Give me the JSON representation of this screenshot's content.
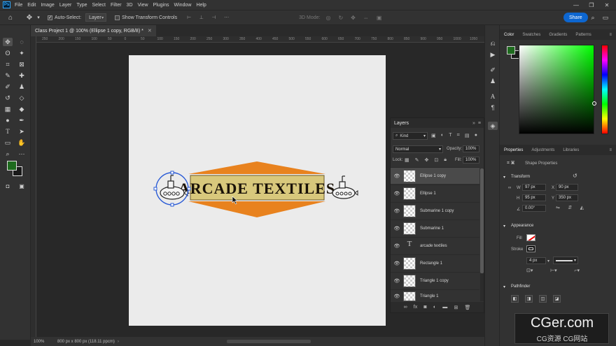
{
  "menu": {
    "logo": "Ps",
    "items": [
      "File",
      "Edit",
      "Image",
      "Layer",
      "Type",
      "Select",
      "Filter",
      "3D",
      "View",
      "Plugins",
      "Window",
      "Help"
    ]
  },
  "options": {
    "auto_select_label": "Auto-Select:",
    "auto_select_value": "Layer",
    "show_transform_label": "Show Transform Controls",
    "mode_3d_label": "3D Mode:",
    "share_label": "Share"
  },
  "document": {
    "tab_title": "Class Project 1 @ 100% (Ellipse 1 copy, RGB/8) *",
    "zoom": "100%",
    "doc_info": "800 px x 800 px (118.11 ppcm)"
  },
  "ruler": {
    "ticks": [
      "250",
      "200",
      "150",
      "100",
      "50",
      "0",
      "50",
      "100",
      "150",
      "200",
      "250",
      "300",
      "350",
      "400",
      "450",
      "500",
      "550",
      "600",
      "650",
      "700",
      "750",
      "800",
      "850",
      "900",
      "950",
      "1000",
      "1050"
    ]
  },
  "artwork": {
    "logo_text": "ARCADE TEXTILES",
    "orange": "#e8821e",
    "banner_fill": "#d8c87c",
    "text_color": "#1a1208",
    "selection_color": "#2a5bd6"
  },
  "tools": {
    "foreground": "#1e6b1e",
    "background": "#1a1a1a"
  },
  "layers_panel": {
    "title": "Layers",
    "filter_kind": "Kind",
    "blend_mode": "Normal",
    "opacity_label": "Opacity:",
    "opacity_value": "100%",
    "lock_label": "Lock:",
    "fill_label": "Fill:",
    "fill_value": "100%",
    "layers": [
      {
        "name": "Ellipse 1 copy",
        "type": "shape",
        "selected": true
      },
      {
        "name": "Ellipse 1",
        "type": "shape",
        "selected": false
      },
      {
        "name": "Submarine 1 copy",
        "type": "shape",
        "selected": false
      },
      {
        "name": "Submarine 1",
        "type": "shape",
        "selected": false
      },
      {
        "name": "arcade textiles",
        "type": "text",
        "selected": false
      },
      {
        "name": "Rectangle 1",
        "type": "shape",
        "selected": false
      },
      {
        "name": "Triangle 1 copy",
        "type": "shape",
        "selected": false
      },
      {
        "name": "Triangle 1",
        "type": "shape",
        "selected": false
      }
    ]
  },
  "color_panel": {
    "tabs": [
      "Color",
      "Swatches",
      "Gradients",
      "Patterns"
    ],
    "picker_hue": "#00ff00"
  },
  "properties_panel": {
    "tabs": [
      "Properties",
      "Adjustments",
      "Libraries"
    ],
    "kind": "Shape Properties",
    "transform_title": "Transform",
    "w_label": "W",
    "w_value": "97 px",
    "x_label": "X",
    "x_value": "90 px",
    "h_label": "H",
    "h_value": "95 px",
    "y_label": "Y",
    "y_value": "350 px",
    "angle_value": "0.00°",
    "appearance_title": "Appearance",
    "fill_label": "Fill",
    "stroke_label": "Stroke",
    "stroke_width": "4 px",
    "pathfinder_title": "Pathfinder"
  },
  "watermark": {
    "title": "CGer.com",
    "subtitle": "CG资源 CG网站"
  }
}
